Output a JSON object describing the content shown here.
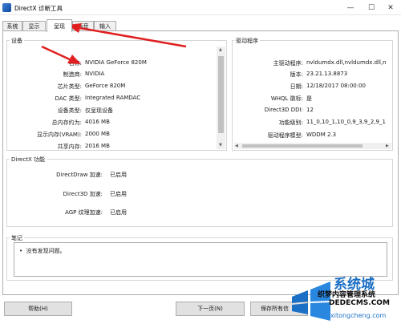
{
  "window": {
    "title": "DirectX 诊断工具",
    "min": "—",
    "max": "☐",
    "close": "✕"
  },
  "tabs": [
    {
      "label": "系统"
    },
    {
      "label": "显示"
    },
    {
      "label": "呈现",
      "active": true
    },
    {
      "label": "声音"
    },
    {
      "label": "输入"
    }
  ],
  "device": {
    "title": "设备",
    "rows": [
      {
        "key": "名称:",
        "value": "NVIDIA GeForce 820M"
      },
      {
        "key": "制造商:",
        "value": "NVIDIA"
      },
      {
        "key": "芯片类型:",
        "value": "GeForce 820M"
      },
      {
        "key": "DAC 类型:",
        "value": "Integrated RAMDAC"
      },
      {
        "key": "设备类型:",
        "value": "仅呈现设备"
      },
      {
        "key": "总内存约为:",
        "value": "4016 MB"
      },
      {
        "key": "显示内存(VRAM):",
        "value": "2000 MB"
      },
      {
        "key": "共享内存:",
        "value": "2016 MB"
      }
    ]
  },
  "driver": {
    "title": "驱动程序",
    "rows": [
      {
        "key": "主驱动程序:",
        "value": "nvldumdx.dll,nvldumdx.dll,nvldumdx.d"
      },
      {
        "key": "版本:",
        "value": "23.21.13.8873"
      },
      {
        "key": "日期:",
        "value": "12/18/2017 08:00:00"
      },
      {
        "key": "WHQL 徽标:",
        "value": "是"
      },
      {
        "key": "Direct3D DDI:",
        "value": "12"
      },
      {
        "key": "功能级别:",
        "value": "11_0,10_1,10_0,9_3,9_2,9_1"
      },
      {
        "key": "驱动程序模型:",
        "value": "WDDM 2.3"
      }
    ]
  },
  "directx": {
    "title": "DirectX 功能",
    "rows": [
      {
        "key": "DirectDraw 加速:",
        "value": "已启用"
      },
      {
        "key": "Direct3D 加速:",
        "value": "已启用"
      },
      {
        "key": "AGP 纹理加速:",
        "value": "已启用"
      }
    ]
  },
  "notes": {
    "title": "笔记",
    "items": [
      "没有发现问题。"
    ]
  },
  "buttons": {
    "help": "帮助(H)",
    "next": "下一页(N)",
    "save": "保存所有信"
  },
  "watermark": {
    "brand": "系统城",
    "line1": "织梦内容管理系统",
    "line2": "DEDECMS.COM",
    "url": "xitongcheng.com"
  },
  "colors": {
    "annotation_red": "#e02020",
    "active_tab_bg": "#ffffff",
    "watermark_blue": "#1b6fc4"
  }
}
